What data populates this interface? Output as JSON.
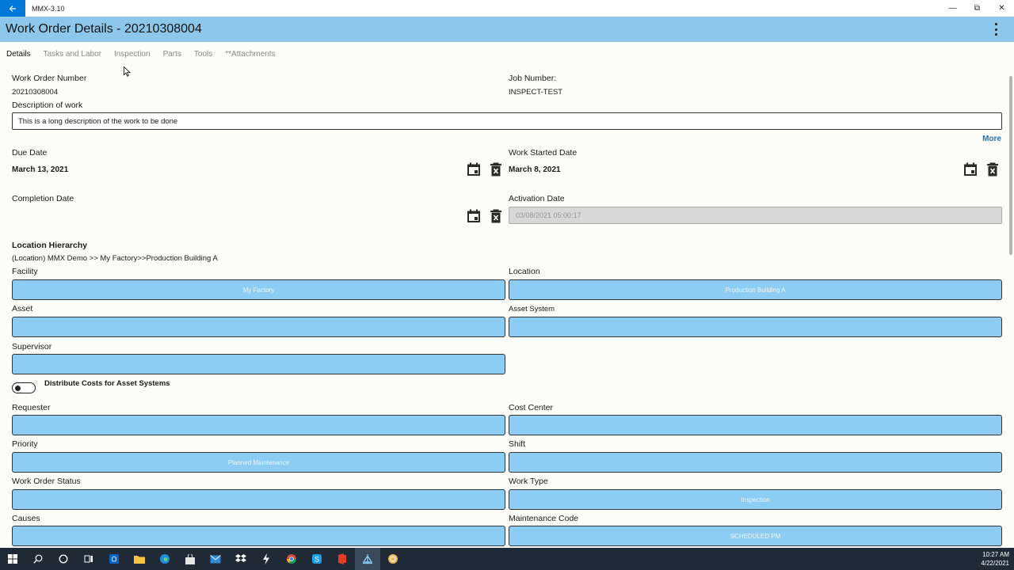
{
  "window": {
    "app_title": "MMX-3.10"
  },
  "header": {
    "title": "Work Order Details - 20210308004"
  },
  "tabs": [
    {
      "label": "Details"
    },
    {
      "label": "Tasks and Labor"
    },
    {
      "label": "Inspection"
    },
    {
      "label": "Parts"
    },
    {
      "label": "Tools"
    },
    {
      "label": "**Attachments"
    }
  ],
  "details": {
    "work_order_number_label": "Work Order Number",
    "work_order_number": "20210308004",
    "job_number_label": "Job Number:",
    "job_number": "INSPECT-TEST",
    "description_label": "Description of work",
    "description_value": "This is a long description of the work to be done",
    "more_label": "More",
    "due_date_label": "Due Date",
    "due_date": "March 13, 2021",
    "work_started_label": "Work Started Date",
    "work_started": "March 8, 2021",
    "completion_label": "Completion Date",
    "activation_label": "Activation Date",
    "activation_value": "03/08/2021 05:00:17"
  },
  "location": {
    "heading": "Location Hierarchy",
    "path": "(Location) MMX Demo >> My Factory>>Production Building A",
    "facility_label": "Facility",
    "facility_value": "My Factory",
    "location_label": "Location",
    "location_value": "Production Building A",
    "asset_label": "Asset",
    "asset_system_label": "Asset System",
    "supervisor_label": "Supervisor",
    "distribute_label": "Distribute Costs for Asset Systems",
    "requester_label": "Requester",
    "cost_center_label": "Cost Center",
    "priority_label": "Priority",
    "priority_value": "Planned Maintenance",
    "shift_label": "Shift",
    "status_label": "Work Order Status",
    "work_type_label": "Work Type",
    "work_type_value": "Inspection",
    "causes_label": "Causes",
    "maintenance_code_label": "Maintenance Code",
    "maintenance_code_value": "SCHEDULED PM"
  },
  "taskbar": {
    "time": "10:27 AM",
    "date": "4/22/2021"
  },
  "colors": {
    "header": "#8dc8ec",
    "field": "#8dcdf3",
    "accent": "#0078d7",
    "link": "#1a73b6"
  }
}
